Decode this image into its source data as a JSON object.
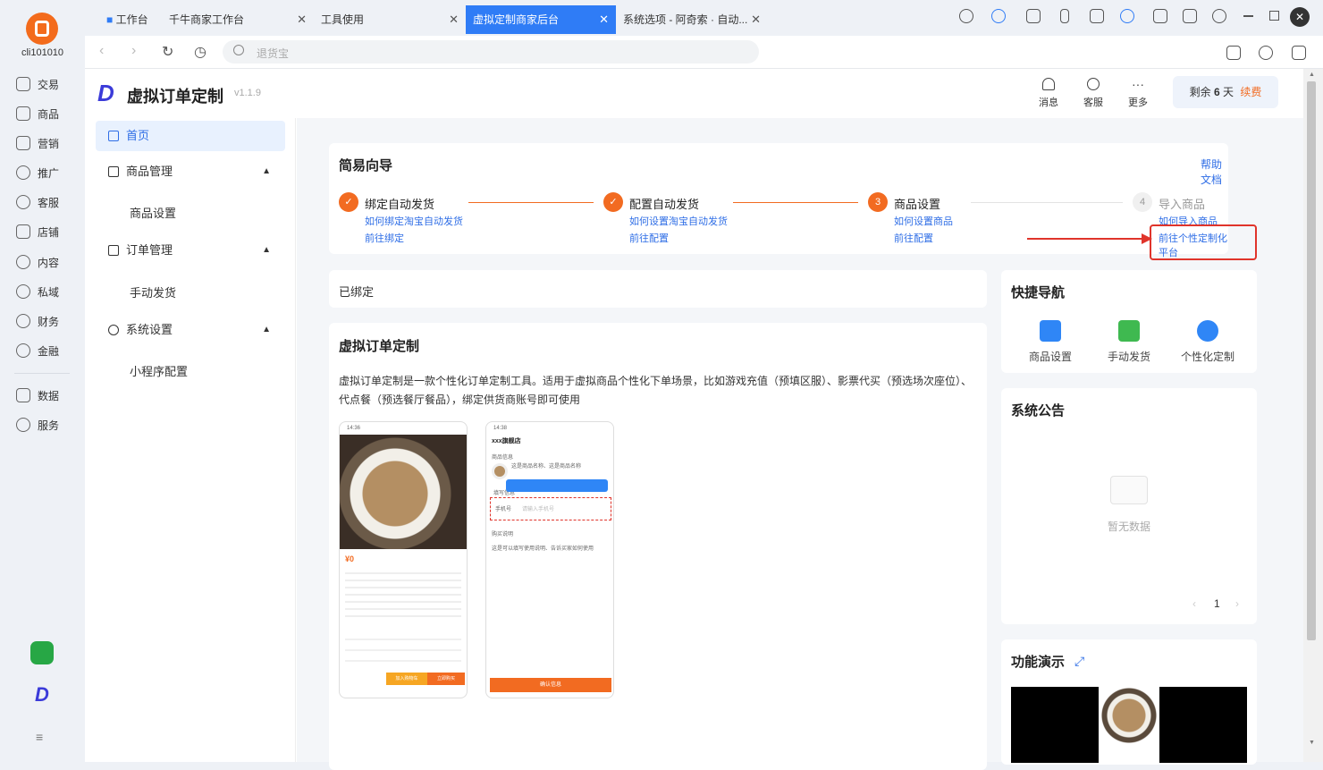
{
  "rail": {
    "user": "cli101010",
    "items": [
      "交易",
      "商品",
      "营销",
      "推广",
      "客服",
      "店铺",
      "内容",
      "私域",
      "财务",
      "金融",
      "数据",
      "服务"
    ]
  },
  "tabs": [
    {
      "label": "工作台",
      "active": false
    },
    {
      "label": "千牛商家工作台",
      "active": false
    },
    {
      "label": "工具使用",
      "active": false
    },
    {
      "label": "虚拟定制商家后台",
      "active": true
    },
    {
      "label": "系统选项 - 阿奇索 · 自动...",
      "active": false
    }
  ],
  "address": {
    "placeholder": "退货宝"
  },
  "app": {
    "name": "虚拟订单定制",
    "version": "v1.1.9",
    "header_actions": [
      "消息",
      "客服",
      "更多"
    ],
    "remain_prefix": "剩余",
    "remain_days": "6",
    "remain_suffix": "天",
    "renew": "续费"
  },
  "sidebar": {
    "home": "首页",
    "goods_mgmt": "商品管理",
    "goods_settings": "商品设置",
    "order_mgmt": "订单管理",
    "manual_ship": "手动发货",
    "sys_settings": "系统设置",
    "mini_config": "小程序配置"
  },
  "guide": {
    "title": "简易向导",
    "help": "帮助文档",
    "steps": [
      {
        "num": "1",
        "name": "绑定自动发货",
        "link1": "如何绑定淘宝自动发货",
        "link2": "前往绑定"
      },
      {
        "num": "2",
        "name": "配置自动发货",
        "link1": "如何设置淘宝自动发货",
        "link2": "前往配置"
      },
      {
        "num": "3",
        "name": "商品设置",
        "link1": "如何设置商品",
        "link2": "前往配置"
      },
      {
        "num": "4",
        "name": "导入商品",
        "link1": "如何导入商品",
        "link2": "前往个性定制化平台"
      }
    ]
  },
  "bound": "已绑定",
  "intro": {
    "title": "虚拟订单定制",
    "desc": "虚拟订单定制是一款个性化订单定制工具。适用于虚拟商品个性化下单场景，比如游戏充值（预填区服）、影票代买（预选场次座位）、代点餐（预选餐厅餐品），绑定供货商账号即可使用"
  },
  "phone1": {
    "time": "14:36",
    "price": "¥0",
    "btn1": "加入购物车",
    "btn2": "立即购买"
  },
  "phone2": {
    "time": "14:38",
    "shop": "xxx旗舰店",
    "sec1": "商品信息",
    "goods": "这是商品名称、这是商品名称",
    "fill": "填写信息",
    "phone_label": "手机号",
    "phone_ph": "请输入手机号",
    "buy": "购买说明",
    "note": "这是可以填写使用说明、告诉买家如何使用",
    "confirm": "确认信息"
  },
  "quicknav": {
    "title": "快捷导航",
    "items": [
      "商品设置",
      "手动发货",
      "个性化定制"
    ]
  },
  "notice": {
    "title": "系统公告",
    "empty": "暂无数据",
    "page": "1"
  },
  "demo": {
    "title": "功能演示"
  },
  "colors": {
    "accent": "#2f6ee6",
    "orange": "#f26b21",
    "tab_active": "#2f7cf6"
  }
}
